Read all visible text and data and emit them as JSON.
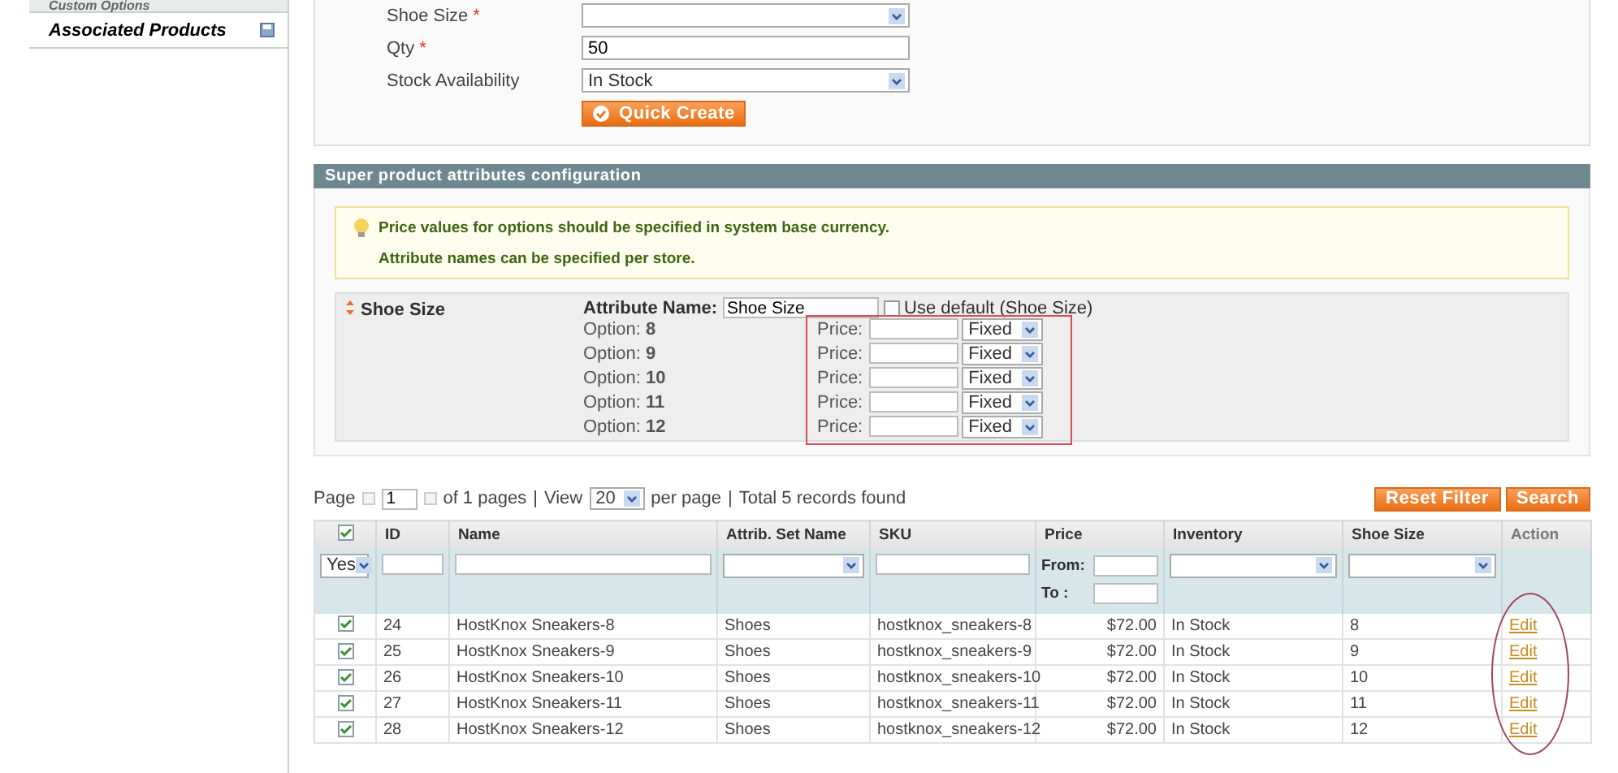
{
  "sidebar": {
    "items": [
      {
        "label": "Custom Options",
        "selected": false
      },
      {
        "label": "Associated Products",
        "selected": true
      }
    ]
  },
  "quick_create": {
    "fields": [
      {
        "kind": "select",
        "label": "Shoe Size",
        "required_mark": "*"
      },
      {
        "kind": "text",
        "label": "Qty",
        "required_mark": "*",
        "value": "50"
      },
      {
        "kind": "select",
        "label": "Stock Availability",
        "value": "In Stock"
      }
    ],
    "button": "Quick Create"
  },
  "super_attributes": {
    "title": "Super product attributes configuration",
    "notices": [
      "Price values for options should be specified in system base currency.",
      "Attribute names can be specified per store."
    ],
    "attribute": {
      "label": "Shoe Size",
      "name_label": "Attribute Name:",
      "name_value": "Shoe Size",
      "use_default_label": "Use default (Shoe Size)",
      "use_default": false,
      "options": [
        {
          "label": "Option:",
          "value": "8",
          "price_label": "Price:",
          "type": "Fixed"
        },
        {
          "label": "Option:",
          "value": "9",
          "price_label": "Price:",
          "type": "Fixed"
        },
        {
          "label": "Option:",
          "value": "10",
          "price_label": "Price:",
          "type": "Fixed"
        },
        {
          "label": "Option:",
          "value": "11",
          "price_label": "Price:",
          "type": "Fixed"
        },
        {
          "label": "Option:",
          "value": "12",
          "price_label": "Price:",
          "type": "Fixed"
        }
      ]
    }
  },
  "pager": {
    "page_label": "Page",
    "page": "1",
    "of_pages": "of 1 pages",
    "sep1": "|",
    "view_label": "View",
    "per_page": "20",
    "per_page_label": "per page",
    "sep2": "|",
    "total": "Total 5 records found"
  },
  "grid_buttons": [
    "Reset Filter",
    "Search"
  ],
  "table": {
    "header_checked": true,
    "columns": [
      "ID",
      "Name",
      "Attrib. Set Name",
      "SKU",
      "Price",
      "Inventory",
      "Shoe Size",
      "Action"
    ],
    "filter": {
      "in_products": "Yes",
      "price_from_label": "From:",
      "price_to_label": "To :"
    },
    "rows": [
      {
        "checked": true,
        "id": "24",
        "name": "HostKnox Sneakers-8",
        "set": "Shoes",
        "sku": "hostknox_sneakers-8",
        "price": "$72.00",
        "inventory": "In Stock",
        "size": "8",
        "action": "Edit"
      },
      {
        "checked": true,
        "id": "25",
        "name": "HostKnox Sneakers-9",
        "set": "Shoes",
        "sku": "hostknox_sneakers-9",
        "price": "$72.00",
        "inventory": "In Stock",
        "size": "9",
        "action": "Edit"
      },
      {
        "checked": true,
        "id": "26",
        "name": "HostKnox Sneakers-10",
        "set": "Shoes",
        "sku": "hostknox_sneakers-10",
        "price": "$72.00",
        "inventory": "In Stock",
        "size": "10",
        "action": "Edit"
      },
      {
        "checked": true,
        "id": "27",
        "name": "HostKnox Sneakers-11",
        "set": "Shoes",
        "sku": "hostknox_sneakers-11",
        "price": "$72.00",
        "inventory": "In Stock",
        "size": "11",
        "action": "Edit"
      },
      {
        "checked": true,
        "id": "28",
        "name": "HostKnox Sneakers-12",
        "set": "Shoes",
        "sku": "hostknox_sneakers-12",
        "price": "$72.00",
        "inventory": "In Stock",
        "size": "12",
        "action": "Edit"
      }
    ]
  }
}
